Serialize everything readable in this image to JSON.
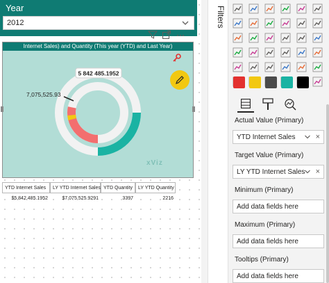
{
  "slicer": {
    "title": "Year",
    "selected": "2012"
  },
  "visual": {
    "title": "Internet Sales) and Quantity (This year (YTD) and Last Year)",
    "watermark": "xViz"
  },
  "chart_data": {
    "type": "donut",
    "title": "",
    "actual_value_label": "5 842 485.1952",
    "target_value_label": "7,075,525.93",
    "actual_value": 5842485.1952,
    "target_value": 7075525.9291,
    "colors": {
      "actual": "#f36f6f",
      "target": "#1ab3a3",
      "track": "#f2f2f2",
      "background": "#b2ddd6",
      "marker": "#f2c811"
    }
  },
  "table": {
    "headers": [
      "YTD Internet Sales",
      "LY YTD Internet Sales",
      "YTD Quantity",
      "LY YTD Quantity"
    ],
    "row": [
      "$5,842,485.1952",
      "$7,075,525.9291",
      "3397",
      "2216"
    ]
  },
  "filters_pane": {
    "label": "Filters"
  },
  "viz_pane": {
    "icons": [
      "stacked-bar-icon",
      "stacked-column-icon",
      "clustered-bar-icon",
      "clustered-column-icon",
      "100-bar-icon",
      "100-column-icon",
      "line-chart-icon",
      "area-chart-icon",
      "stacked-area-icon",
      "line-column-icon",
      "line-clustered-icon",
      "ribbon-chart-icon",
      "waterfall-icon",
      "funnel-icon",
      "scatter-icon",
      "pie-chart-icon",
      "donut-chart-icon",
      "treemap-icon",
      "map-icon",
      "filled-map-icon",
      "shape-map-icon",
      "gauge-icon",
      "card-icon",
      "multirow-card-icon",
      "kpi-icon",
      "slicer-icon",
      "table-icon",
      "matrix-icon",
      "r-visual-icon",
      "python-visual-icon",
      "key-influencers-icon",
      "decomposition-tree-icon",
      "qa-icon",
      "smart-narrative-icon",
      "paginated-icon",
      "powerapps-icon"
    ],
    "custom_icons": [
      "custom-visual-1-icon",
      "custom-visual-2-icon",
      "custom-visual-3-icon",
      "custom-visual-4-icon",
      "custom-visual-5-icon"
    ],
    "tabs": [
      "fields-tab-icon",
      "format-tab-icon",
      "analytics-tab-icon"
    ],
    "wells": [
      {
        "label": "Actual Value (Primary)",
        "value": "YTD Internet Sales",
        "filled": true
      },
      {
        "label": "Target Value (Primary)",
        "value": "LY YTD Internet Sales",
        "filled": true
      },
      {
        "label": "Minimum (Primary)",
        "value": "Add data fields here",
        "filled": false
      },
      {
        "label": "Maximum (Primary)",
        "value": "Add data fields here",
        "filled": false
      },
      {
        "label": "Tooltips (Primary)",
        "value": "Add data fields here",
        "filled": false
      }
    ]
  }
}
